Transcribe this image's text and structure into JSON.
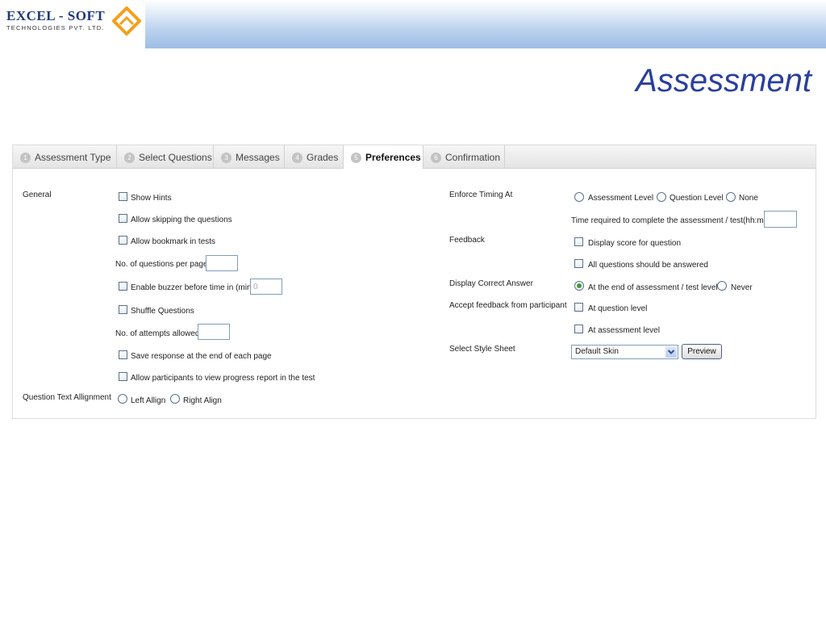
{
  "brand": {
    "logo_main": "EXCEL - SOFT",
    "logo_sub": "TECHNOLOGIES  PVT.  LTD."
  },
  "page_title": "Assessment",
  "tabs": [
    {
      "num": "1",
      "label": "Assessment Type"
    },
    {
      "num": "2",
      "label": "Select Questions"
    },
    {
      "num": "3",
      "label": "Messages"
    },
    {
      "num": "4",
      "label": "Grades"
    },
    {
      "num": "5",
      "label": "Preferences",
      "active": true
    },
    {
      "num": "6",
      "label": "Confirmation"
    }
  ],
  "general": {
    "section_label": "General",
    "show_hints": "Show Hints",
    "allow_skipping": "Allow skipping the questions",
    "allow_bookmark": "Allow bookmark in tests",
    "questions_per_page": "No. of questions per page",
    "enable_buzzer": "Enable buzzer before time in (min)",
    "buzzer_value": "0",
    "shuffle": "Shuffle Questions",
    "attempts_allowed": "No. of attempts allowed",
    "save_response": "Save response at the end of each page",
    "view_progress": "Allow participants to view progress report in the test"
  },
  "alignment": {
    "section_label": "Question Text Allignment",
    "left": "Left Allign",
    "right": "Right Align"
  },
  "timing": {
    "section_label": "Enforce Timing At",
    "assessment_level": "Assessment Level",
    "question_level": "Question Level",
    "none": "None",
    "time_required": "Time required to complete the assessment / test(hh:mm)"
  },
  "feedback": {
    "section_label": "Feedback",
    "display_score": "Display score for question",
    "all_answered": "All questions should be answered"
  },
  "correct_answer": {
    "section_label": "Display Correct Answer",
    "end_of_assessment": "At the end of assessment / test level",
    "never": "Never",
    "selected": "end_of_assessment"
  },
  "participant_feedback": {
    "section_label": "Accept feedback from participant",
    "question_level": "At question level",
    "assessment_level": "At assessment level"
  },
  "style_sheet": {
    "section_label": "Select Style Sheet",
    "selected": "Default Skin",
    "preview_label": "Preview"
  }
}
